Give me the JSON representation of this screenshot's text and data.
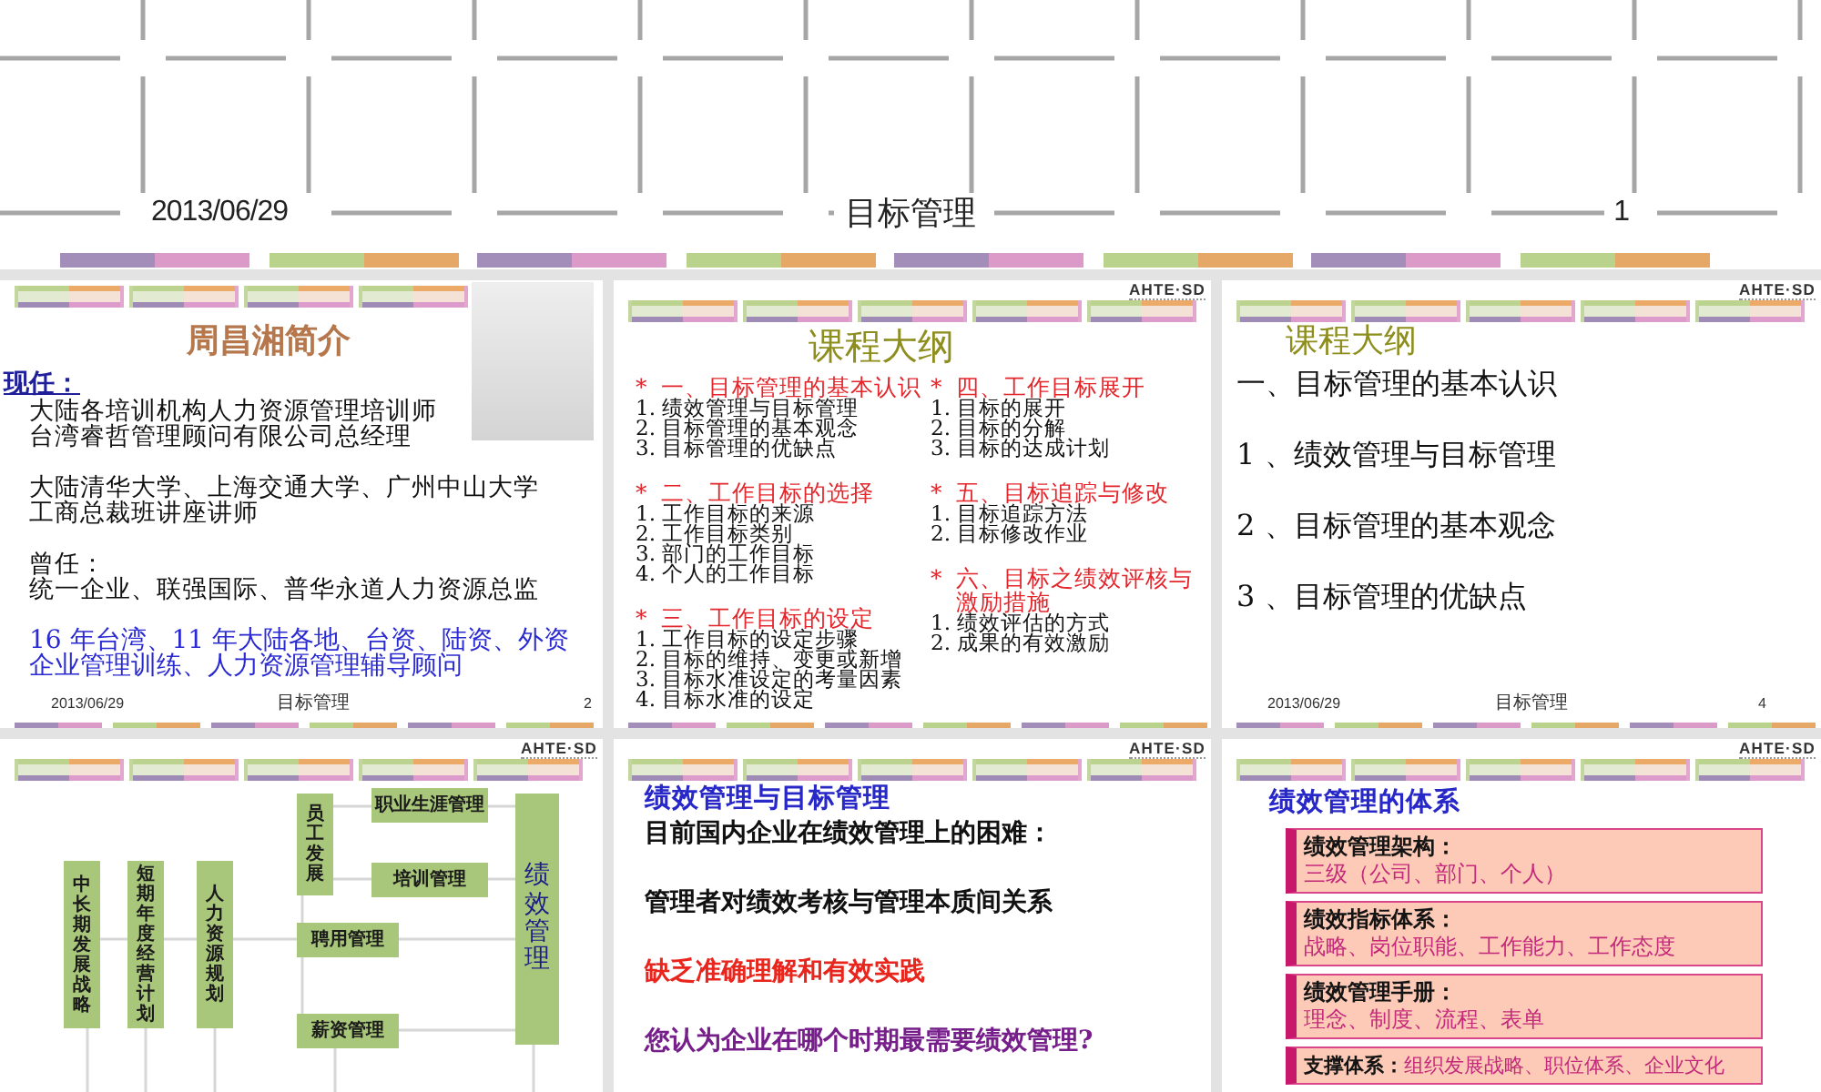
{
  "slides": [
    {
      "kind": "cover",
      "footer": {
        "date": "2013/06/29",
        "title": "目标管理",
        "page": "1"
      }
    },
    {
      "kind": "profile",
      "title": "周昌湘简介",
      "heading": "现任：",
      "blocks": [
        {
          "kind": "plain",
          "lines": [
            "大陆各培训机构人力资源管理培训师",
            "台湾睿哲管理顾问有限公司总经理"
          ]
        },
        {
          "kind": "plain",
          "lines": [
            "大陆清华大学、上海交通大学、广州中山大学工商总裁班讲座讲师"
          ]
        },
        {
          "kind": "plain",
          "lines": [
            "曾任：",
            "统一企业、联强国际、普华永道人力资源总监"
          ]
        },
        {
          "kind": "highlight",
          "lines": [
            "16 年台湾、11 年大陆各地、台资、陆资、外资企业管理训练、人力资源管理辅导顾问"
          ]
        }
      ],
      "footer": {
        "date": "2013/06/29",
        "title": "目标管理",
        "page": "2"
      }
    },
    {
      "kind": "outline",
      "logo": "AHTE·SD",
      "title": "课程大纲",
      "columns": [
        {
          "sections": [
            {
              "marker": "*",
              "heading": "一、目标管理的基本认识",
              "items": [
                "1. 绩效管理与目标管理",
                "2. 目标管理的基本观念",
                "3. 目标管理的优缺点"
              ]
            },
            {
              "marker": "*",
              "heading": "二、工作目标的选择",
              "items": [
                "1. 工作目标的来源",
                "2. 工作目标类别",
                "3. 部门的工作目标",
                "4. 个人的工作目标"
              ]
            },
            {
              "marker": "*",
              "heading": "三、工作目标的设定",
              "items": [
                "1. 工作目标的设定步骤",
                "2. 目标的维持、变更或新增",
                "3. 目标水准设定的考量因素",
                "4. 目标水准的设定"
              ]
            }
          ]
        },
        {
          "sections": [
            {
              "marker": "*",
              "heading": "四、工作目标展开",
              "items": [
                "1. 目标的展开",
                "2. 目标的分解",
                "3. 目标的达成计划"
              ]
            },
            {
              "marker": "*",
              "heading": "五、目标追踪与修改",
              "items": [
                "1. 目标追踪方法",
                "2. 目标修改作业"
              ]
            },
            {
              "marker": "*",
              "heading": "六、目标之绩效评核与激励措施",
              "items": [
                "1. 绩效评估的方式",
                "2. 成果的有效激励"
              ]
            }
          ]
        }
      ]
    },
    {
      "kind": "agenda",
      "logo": "AHTE·SD",
      "title": "课程大纲",
      "lines": [
        "一、目标管理的基本认识",
        "1 、绩效管理与目标管理",
        "2 、目标管理的基本观念",
        "3 、目标管理的优缺点"
      ],
      "footer": {
        "date": "2013/06/29",
        "title": "目标管理",
        "page": "4"
      }
    },
    {
      "kind": "diagram",
      "logo": "AHTE·SD",
      "nodes": [
        {
          "kind": "vertical",
          "label": "中长期发展战略"
        },
        {
          "kind": "vertical",
          "label": "短期年度经营计划"
        },
        {
          "kind": "vertical",
          "label": "人力资源规划"
        },
        {
          "kind": "vertical",
          "label": "员工发展"
        },
        {
          "kind": "horizontal",
          "label": "职业生涯管理"
        },
        {
          "kind": "horizontal",
          "label": "培训管理"
        },
        {
          "kind": "horizontal",
          "label": "聘用管理"
        },
        {
          "kind": "horizontal",
          "label": "薪资管理"
        },
        {
          "kind": "target",
          "label": "绩效管理"
        }
      ]
    },
    {
      "kind": "notes",
      "logo": "AHTE·SD",
      "title": "绩效管理与目标管理",
      "lines": [
        {
          "kind": "plain",
          "text": "目前国内企业在绩效管理上的困难："
        },
        {
          "kind": "plain",
          "text": "管理者对绩效考核与管理本质间关系"
        },
        {
          "kind": "alert",
          "text": "缺乏准确理解和有效实践"
        },
        {
          "kind": "question",
          "text": "您认为企业在哪个时期最需要绩效管理?"
        }
      ]
    },
    {
      "kind": "system",
      "logo": "AHTE·SD",
      "title": "绩效管理的体系",
      "boxes": [
        {
          "kind": "stacked",
          "label": "绩效管理架构：",
          "text": "三级（公司、部门、个人）"
        },
        {
          "kind": "stacked",
          "label": "绩效指标体系：",
          "text": "战略、岗位职能、工作能力、工作态度"
        },
        {
          "kind": "stacked",
          "label": "绩效管理手册：",
          "text": "理念、制度、流程、表单"
        },
        {
          "kind": "inline",
          "label": "支撑体系：",
          "text": "组织发展战略、职位体系、企业文化"
        }
      ]
    }
  ]
}
